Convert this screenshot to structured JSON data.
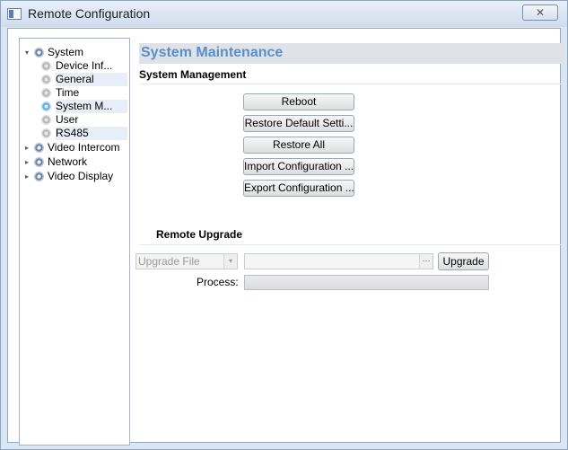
{
  "window": {
    "title": "Remote Configuration",
    "close_icon": "close-icon"
  },
  "tree": {
    "system": "System",
    "children": [
      "Device Inf...",
      "General",
      "Time",
      "System M...",
      "User",
      "RS485"
    ],
    "video_intercom": "Video Intercom",
    "network": "Network",
    "video_display": "Video Display"
  },
  "main": {
    "section_title": "System Maintenance",
    "management_title": "System Management",
    "buttons": {
      "reboot": "Reboot",
      "restore_default": "Restore Default Setti...",
      "restore_all": "Restore All",
      "import_config": "Import Configuration ...",
      "export_config": "Export Configuration ..."
    },
    "remote_upgrade_title": "Remote Upgrade",
    "upgrade_file_select": "Upgrade File",
    "file_path": "",
    "browse_label": "···",
    "upgrade_button": "Upgrade",
    "process_label": "Process:",
    "process_value": 0
  }
}
